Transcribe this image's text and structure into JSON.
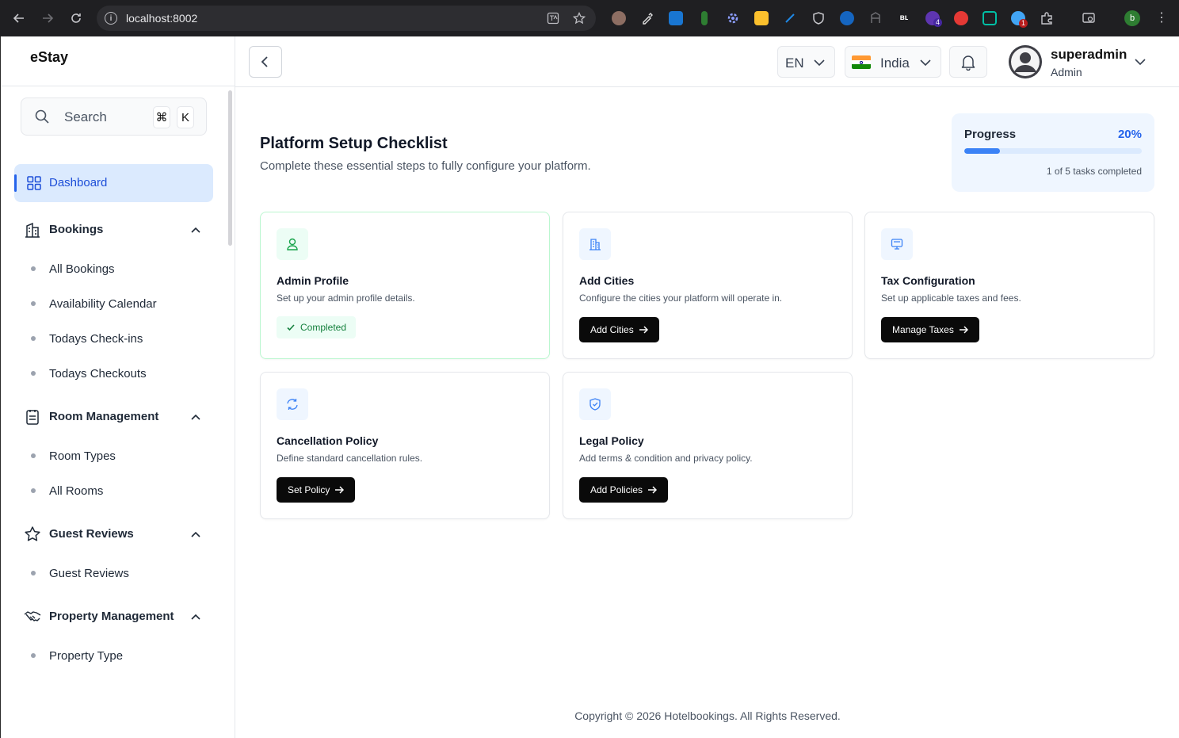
{
  "browser": {
    "url": "localhost:8002",
    "profile_initial": "b",
    "extension_badges": [
      "4",
      "1"
    ]
  },
  "sidebar": {
    "brand": "eStay",
    "search": {
      "placeholder": "Search",
      "shortcut_keys": [
        "⌘",
        "K"
      ]
    },
    "active_item": {
      "label": "Dashboard",
      "icon": "dashboard-grid-icon"
    },
    "groups": [
      {
        "label": "Bookings",
        "icon": "building-icon",
        "expanded": true,
        "items": [
          "All Bookings",
          "Availability Calendar",
          "Todays Check-ins",
          "Todays Checkouts"
        ]
      },
      {
        "label": "Room Management",
        "icon": "clipboard-icon",
        "expanded": true,
        "items": [
          "Room Types",
          "All Rooms"
        ]
      },
      {
        "label": "Guest Reviews",
        "icon": "star-icon",
        "expanded": true,
        "items": [
          "Guest Reviews"
        ]
      },
      {
        "label": "Property Management",
        "icon": "handshake-icon",
        "expanded": true,
        "items": [
          "Property Type"
        ]
      }
    ]
  },
  "header": {
    "language": "EN",
    "country": "India",
    "user": {
      "name": "superadmin",
      "role": "Admin"
    }
  },
  "main": {
    "title": "Platform Setup Checklist",
    "subtitle": "Complete these essential steps to fully configure your platform.",
    "progress": {
      "label": "Progress",
      "percent_text": "20%",
      "fraction": 0.2,
      "status": "1 of 5 tasks completed"
    },
    "cards": [
      {
        "title": "Admin Profile",
        "description": "Set up your admin profile details.",
        "icon": "user-icon",
        "completed": true,
        "badge": "Completed"
      },
      {
        "title": "Add Cities",
        "description": "Configure the cities your platform will operate in.",
        "icon": "building-icon",
        "completed": false,
        "button": "Add Cities"
      },
      {
        "title": "Tax Configuration",
        "description": "Set up applicable taxes and fees.",
        "icon": "monitor-icon",
        "completed": false,
        "button": "Manage Taxes"
      },
      {
        "title": "Cancellation Policy",
        "description": "Define standard cancellation rules.",
        "icon": "refresh-icon",
        "completed": false,
        "button": "Set Policy"
      },
      {
        "title": "Legal Policy",
        "description": "Add terms & condition and privacy policy.",
        "icon": "shield-check-icon",
        "completed": false,
        "button": "Add Policies"
      }
    ]
  },
  "colors": {
    "accent": "#2563eb",
    "active_nav_bg": "#dbeafe",
    "success": "#15803d",
    "button_bg": "#0a0a0a"
  },
  "footer": {
    "copyright": "Copyright © 2026 Hotelbookings. All Rights Reserved."
  }
}
